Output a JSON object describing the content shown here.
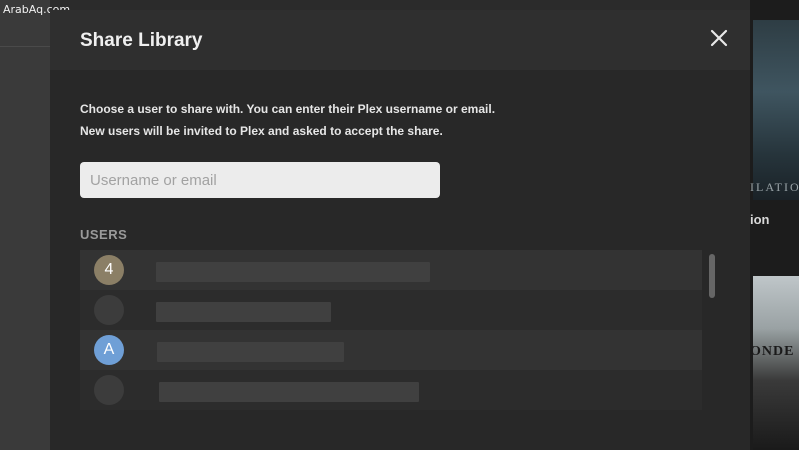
{
  "watermark": "ArabAq.com",
  "background": {
    "poster_1_text": "ILATIO",
    "poster_1_subtitle": "ion",
    "poster_2_text": "ONDE"
  },
  "modal": {
    "title": "Share Library",
    "description_line_1": "Choose a user to share with. You can enter their Plex username or email.",
    "description_line_2": "New users will be invited to Plex and asked to accept the share.",
    "search": {
      "placeholder": "Username or email",
      "value": ""
    },
    "users_label": "USERS",
    "users": [
      {
        "avatar": "4",
        "avatar_color": "#8b7f66"
      },
      {
        "avatar": "",
        "avatar_color": "#3c3c3c"
      },
      {
        "avatar": "A",
        "avatar_color": "#6f9fd6"
      },
      {
        "avatar": "",
        "avatar_color": "#3c3c3c"
      }
    ]
  },
  "icons": {
    "close": "close-icon"
  }
}
